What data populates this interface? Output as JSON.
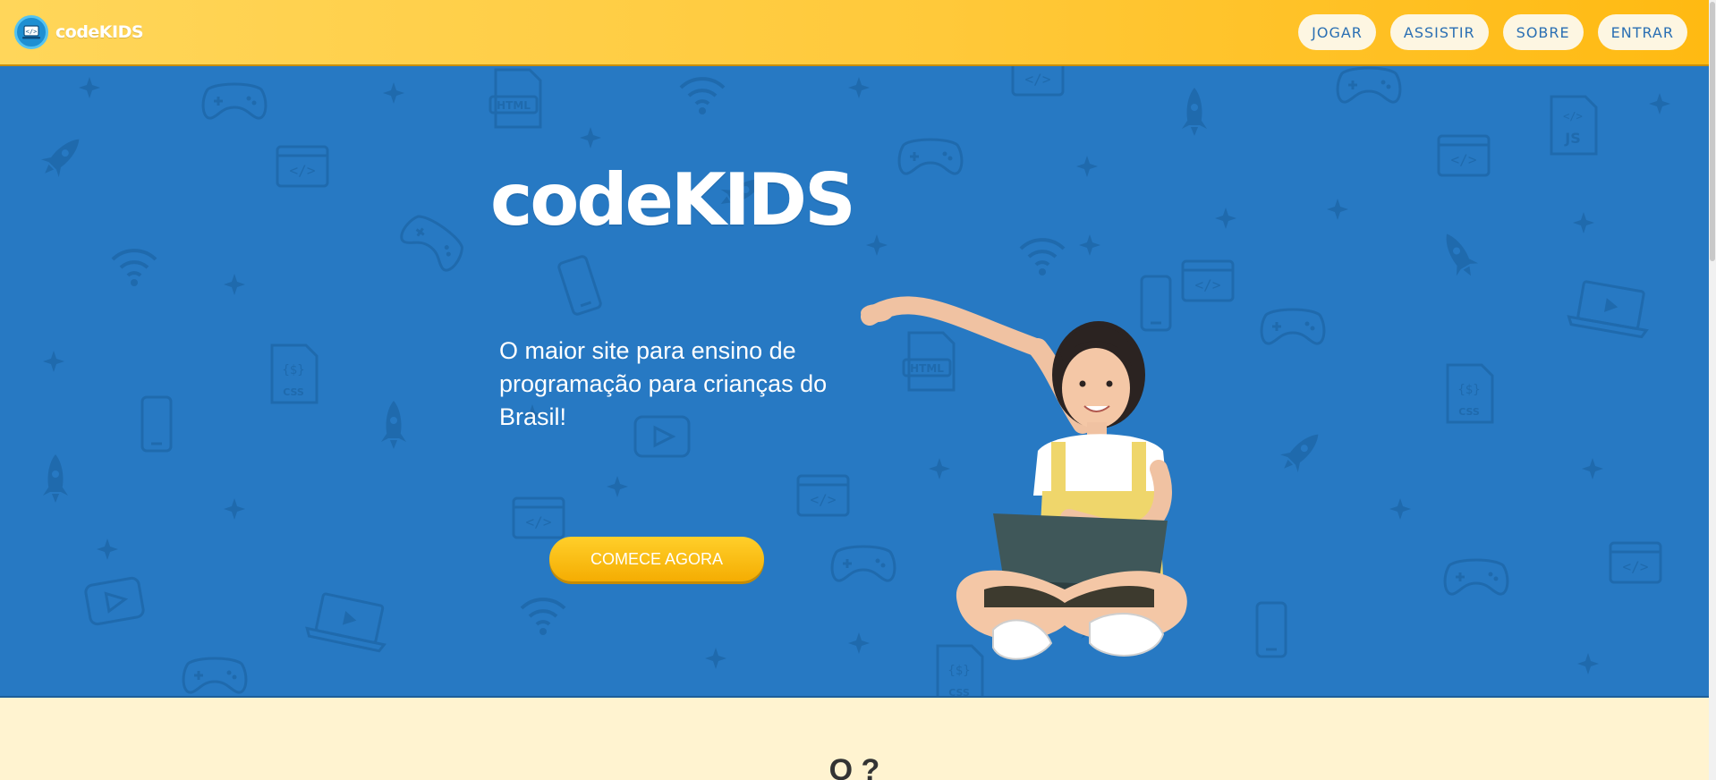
{
  "header": {
    "brand_name": "codeKIDS",
    "nav": [
      "JOGAR",
      "ASSISTIR",
      "SOBRE",
      "ENTRAR"
    ]
  },
  "hero": {
    "title": "codeKIDS",
    "subtitle": "O maior site para ensino de programação para crianças do Brasil!",
    "cta_label": "COMECE AGORA"
  },
  "next_section": {
    "heading_partial": "O        ?"
  },
  "colors": {
    "header_start": "#ffd65a",
    "header_end": "#ffba12",
    "hero_bg": "#2779c3",
    "nav_text": "#2a6fb3",
    "cta": "#f5ad02",
    "page_bg": "#fff3d0"
  },
  "icons": [
    "code-icon",
    "rocket-icon",
    "gamepad-icon",
    "wifi-icon",
    "html-file-icon",
    "css-file-icon",
    "js-file-icon",
    "phone-icon",
    "laptop-icon",
    "play-icon",
    "sparkle-icon"
  ]
}
